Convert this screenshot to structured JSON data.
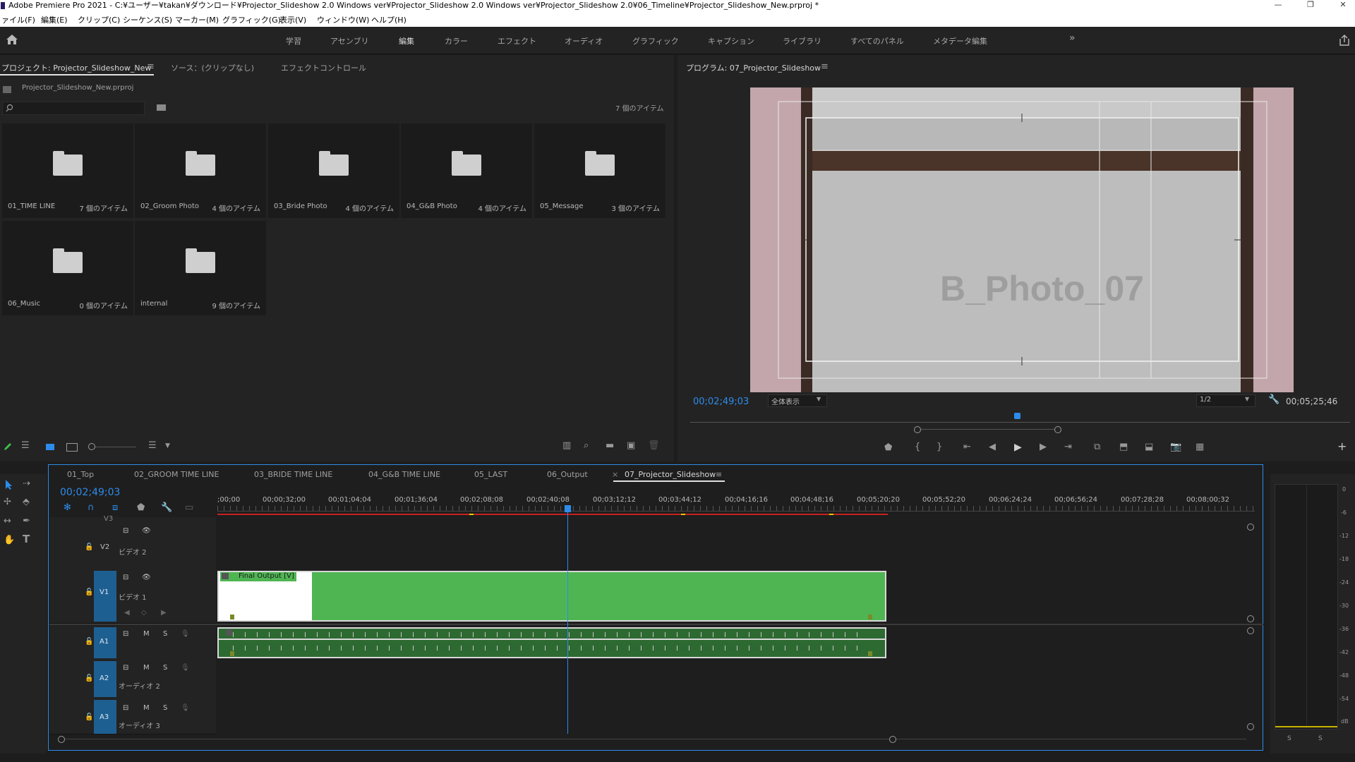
{
  "window": {
    "title": "Adobe Premiere Pro 2021 - C:¥ユーザー¥takan¥ダウンロード¥Projector_Slideshow 2.0 Windows ver¥Projector_Slideshow 2.0 Windows ver¥Projector_Slideshow 2.0¥06_Timeline¥Projector_Slideshow_New.prproj *",
    "minimize": "—",
    "restore": "❐",
    "close": "✕"
  },
  "menu": [
    "ァイル(F)",
    "編集(E)",
    "クリップ(C)",
    "シーケンス(S)",
    "マーカー(M)",
    "グラフィック(G)",
    "表示(V)",
    "ウィンドウ(W)",
    "ヘルプ(H)"
  ],
  "workspaces": [
    "学習",
    "アセンブリ",
    "編集",
    "カラー",
    "エフェクト",
    "オーディオ",
    "グラフィック",
    "キャプション",
    "ライブラリ",
    "すべてのパネル",
    "メタデータ編集"
  ],
  "workspace_more": "»",
  "project": {
    "tabs": [
      "プロジェクト: Projector_Slideshow_New",
      "ソース：(クリップなし)",
      "エフェクトコントロール"
    ],
    "file": "Projector_Slideshow_New.prproj",
    "search_placeholder": "",
    "item_count": "7 個のアイテム",
    "bins": [
      {
        "name": "01_TIME LINE",
        "count": "7 個のアイテム"
      },
      {
        "name": "02_Groom Photo",
        "count": "4 個のアイテム"
      },
      {
        "name": "03_Bride Photo",
        "count": "4 個のアイテム"
      },
      {
        "name": "04_G&B Photo",
        "count": "4 個のアイテム"
      },
      {
        "name": "05_Message",
        "count": "3 個のアイテム"
      },
      {
        "name": "06_Music",
        "count": "0 個のアイテム"
      },
      {
        "name": "internal",
        "count": "9 個のアイテム"
      }
    ]
  },
  "program": {
    "tab": "プログラム: 07_Projector_Slideshow",
    "overlay_text": "B_Photo_07",
    "timecode": "00;02;49;03",
    "fit": "全体表示",
    "resolution": "1/2",
    "duration": "00;05;25;46",
    "playhead_position": 0.495
  },
  "timeline": {
    "tabs": [
      "01_Top",
      "02_GROOM TIME LINE",
      "03_BRIDE TIME LINE",
      "04_G&B TIME LINE",
      "05_LAST",
      "06_Output",
      "07_Projector_Slideshow"
    ],
    "active_tab_close": "×",
    "timecode": "00;02;49;03",
    "ruler": [
      ";00;00",
      "00;00;32;00",
      "00;01;04;04",
      "00;01;36;04",
      "00;02;08;08",
      "00;02;40;08",
      "00;03;12;12",
      "00;03;44;12",
      "00;04;16;16",
      "00;04;48;16",
      "00;05;20;20",
      "00;05;52;20",
      "00;06;24;24",
      "00;06;56;24",
      "00;07;28;28",
      "00;08;00;32"
    ],
    "tracks": {
      "v3": "V3",
      "v2": {
        "label": "V2",
        "name": "ビデオ 2"
      },
      "v1": {
        "label": "V1",
        "name": "ビデオ 1"
      },
      "a1": {
        "label": "A1"
      },
      "a2": {
        "label": "A2",
        "name": "オーディオ 2"
      },
      "a3": {
        "label": "A3",
        "name": "オーディオ 3"
      }
    },
    "clip_label": "Final Output [V]",
    "track_buttons": {
      "m": "M",
      "s": "S"
    }
  },
  "meter": {
    "scale": [
      "0",
      "-6",
      "-12",
      "-18",
      "-24",
      "-30",
      "-36",
      "-42",
      "-48",
      "-54",
      "dB"
    ],
    "solo": [
      "S",
      "S"
    ]
  },
  "colors": {
    "accent": "#2d8ceb",
    "clip_green": "#4fb553",
    "audio_green": "#2d6a32",
    "target_blue": "#1e5f91"
  }
}
